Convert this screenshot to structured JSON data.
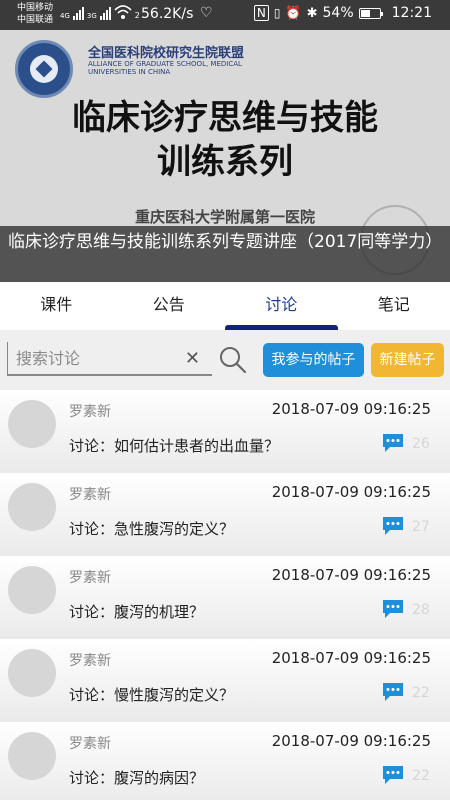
{
  "status_bar": {
    "carrier1": "中国移动",
    "carrier2": "中国联通",
    "net1": "4G",
    "net2": "3G",
    "wifi_sub": "2",
    "speed": "56.2K/s",
    "battery": "54%",
    "battery_level": 0.54,
    "time": "12:21"
  },
  "banner": {
    "alliance_cn": "全国医科院校研究生院联盟",
    "alliance_en": "ALLIANCE OF GRADUATE SCHOOL, MEDICAL UNIVERSITIES IN CHINA",
    "title_line1": "临床诊疗思维与技能",
    "title_line2": "训练系列",
    "hospital": "重庆医科大学附属第一医院",
    "caption": "临床诊疗思维与技能训练系列专题讲座（2017同等学力）"
  },
  "tabs": [
    "课件",
    "公告",
    "讨论",
    "笔记"
  ],
  "active_tab": 2,
  "search": {
    "placeholder": "搜索讨论",
    "my_posts": "我参与的帖子",
    "new_post": "新建帖子"
  },
  "posts": [
    {
      "author": "罗素新",
      "time": "2018-07-09 09:16:25",
      "topic": "讨论：如何估计患者的出血量？",
      "count": "26"
    },
    {
      "author": "罗素新",
      "time": "2018-07-09 09:16:25",
      "topic": "讨论：急性腹泻的定义？",
      "count": "27"
    },
    {
      "author": "罗素新",
      "time": "2018-07-09 09:16:25",
      "topic": "讨论：腹泻的机理？",
      "count": "28"
    },
    {
      "author": "罗素新",
      "time": "2018-07-09 09:16:25",
      "topic": "讨论：慢性腹泻的定义？",
      "count": "22"
    },
    {
      "author": "罗素新",
      "time": "2018-07-09 09:16:25",
      "topic": "讨论：腹泻的病因？",
      "count": "22"
    }
  ],
  "colors": {
    "active_tab_indicator": "#13237a",
    "primary_button": "#1e8fd8",
    "secondary_button": "#f2b732",
    "chat_icon": "#1e8fd8"
  }
}
